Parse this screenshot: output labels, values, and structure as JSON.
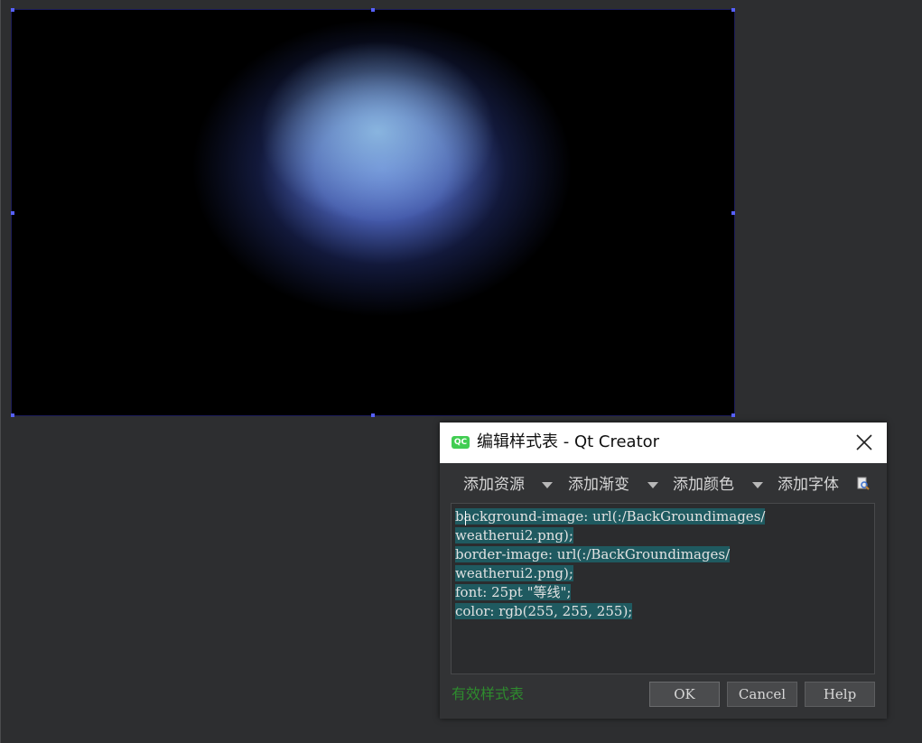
{
  "dialog": {
    "app_icon_label": "QC",
    "title": "编辑样式表 - Qt Creator",
    "toolbar": {
      "add_resource": "添加资源",
      "add_gradient": "添加渐变",
      "add_color": "添加颜色",
      "add_font": "添加字体"
    },
    "code_lines": [
      "background-image: url(:/BackGroundimages/",
      "weatherui2.png);",
      "border-image: url(:/BackGroundimages/",
      "weatherui2.png);",
      "font: 25pt \"等线\";",
      "color: rgb(255, 255, 255);"
    ],
    "status": "有效样式表",
    "buttons": {
      "ok": "OK",
      "cancel": "Cancel",
      "help": "Help"
    }
  },
  "colors": {
    "background": "#2d2e30",
    "dialog_bg": "#323335",
    "selection": "#1f5a60",
    "status_valid": "#2e8b2e",
    "qt_green": "#41cd52",
    "handle": "#5660ff"
  },
  "icons": [
    "qt-creator-icon",
    "close-icon",
    "dropdown-arrow-icon",
    "font-picker-icon"
  ]
}
